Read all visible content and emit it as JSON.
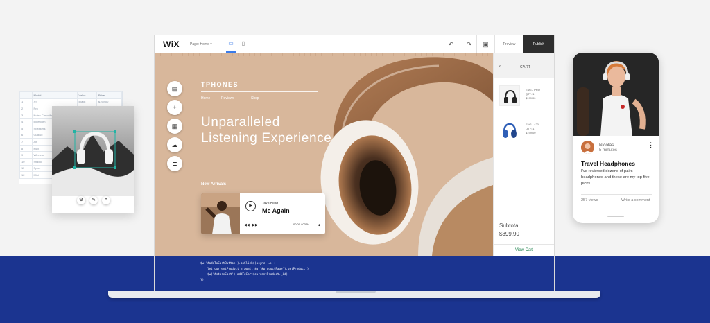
{
  "spreadsheet": {
    "headers": [
      "",
      "Model",
      "Value",
      "Price"
    ],
    "rows": [
      [
        "1",
        "XS",
        "Black",
        "$199.00"
      ],
      [
        "2",
        "Pro",
        "White",
        "$249.00"
      ],
      [
        "3",
        "Noise Cancelling",
        "",
        ""
      ],
      [
        "4",
        "Bluetooth",
        "",
        ""
      ],
      [
        "5",
        "Speakers",
        "",
        ""
      ],
      [
        "6",
        "Classic",
        "",
        ""
      ],
      [
        "7",
        "Air",
        "",
        ""
      ],
      [
        "8",
        "Max",
        "",
        ""
      ],
      [
        "9",
        "Wireless",
        "",
        ""
      ],
      [
        "10",
        "Studio",
        "",
        ""
      ],
      [
        "11",
        "Sport",
        "",
        ""
      ],
      [
        "12",
        "Mini",
        "",
        ""
      ]
    ]
  },
  "editor": {
    "logo": "WiX",
    "page_selector": "Page: Home",
    "preview_label": "Preview",
    "publish_label": "Publish",
    "site": {
      "brand": "TPHONES",
      "nav": [
        "Home",
        "Reviews",
        "Shop"
      ],
      "hero_line1": "Unparalleled",
      "hero_line2": "Listening Experience",
      "section_label": "New Arrivals",
      "player": {
        "artist": "Jake Blind",
        "song": "Me Again",
        "time": "00:00 / 03:54"
      }
    },
    "cart": {
      "title": "CART",
      "items": [
        {
          "name": "ENG - PRO",
          "qty": "QTY: 1",
          "price": "$199.00"
        },
        {
          "name": "ENG - 420",
          "qty": "QTY: 1",
          "price": "$199.00"
        }
      ],
      "subtotal_label": "Subtotal",
      "subtotal_value": "$399.90",
      "view_cart": "View Cart"
    },
    "code": [
      "$w('#addToCartButton').onClick((async) => {",
      "    let currentProduct = await $w('#productPage').getProduct()",
      "    $w('#storeCart').addToCart(currentProduct._id)",
      "})"
    ]
  },
  "phone": {
    "author": "Nicolas",
    "time": "5 minutes",
    "title": "Travel Headphones",
    "body": "I've reviewed dozens of pairs headphones and these are my top five picks",
    "views": "257 views",
    "write_comment": "Write a comment"
  },
  "colors": {
    "band": "#1b3490",
    "canvas": "#d8b79b",
    "accent": "#3b7be8",
    "view_cart": "#117a42"
  }
}
